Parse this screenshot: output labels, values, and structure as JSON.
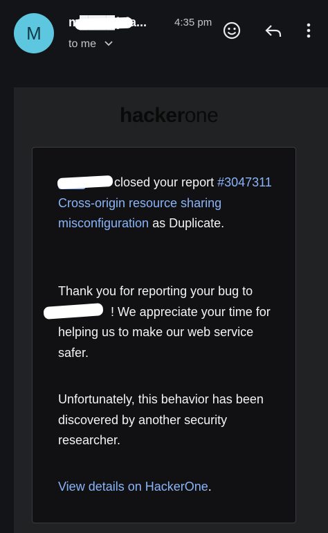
{
  "header": {
    "avatar_letter": "M",
    "sender": "m████(via...",
    "time": "4:35 pm",
    "to": "to me"
  },
  "icons": {
    "emoji": "smiley-icon",
    "reply": "reply-icon",
    "more": "more-vertical-icon",
    "expand": "chevron-down-icon"
  },
  "email": {
    "logo": {
      "part1": "hacker",
      "part2": "one"
    },
    "p1": {
      "after_name": " closed your report ",
      "report_link": "#3047311 Cross-origin resource sharing misconfiguration",
      "suffix": " as Duplicate."
    },
    "p2": {
      "prefix": "Thank you for reporting your bug to ",
      "rest": "! We appreciate your time for helping us to make our web service safer."
    },
    "p3": "Unfortunately, this behavior has been discovered by another security researcher.",
    "p4": {
      "link": "View details on HackerOne",
      "suffix": "."
    }
  },
  "colors": {
    "background": "#121417",
    "avatar": "#5ec7e0",
    "link": "#8ab4f8",
    "card": "#111113",
    "body_bg": "#212224"
  }
}
